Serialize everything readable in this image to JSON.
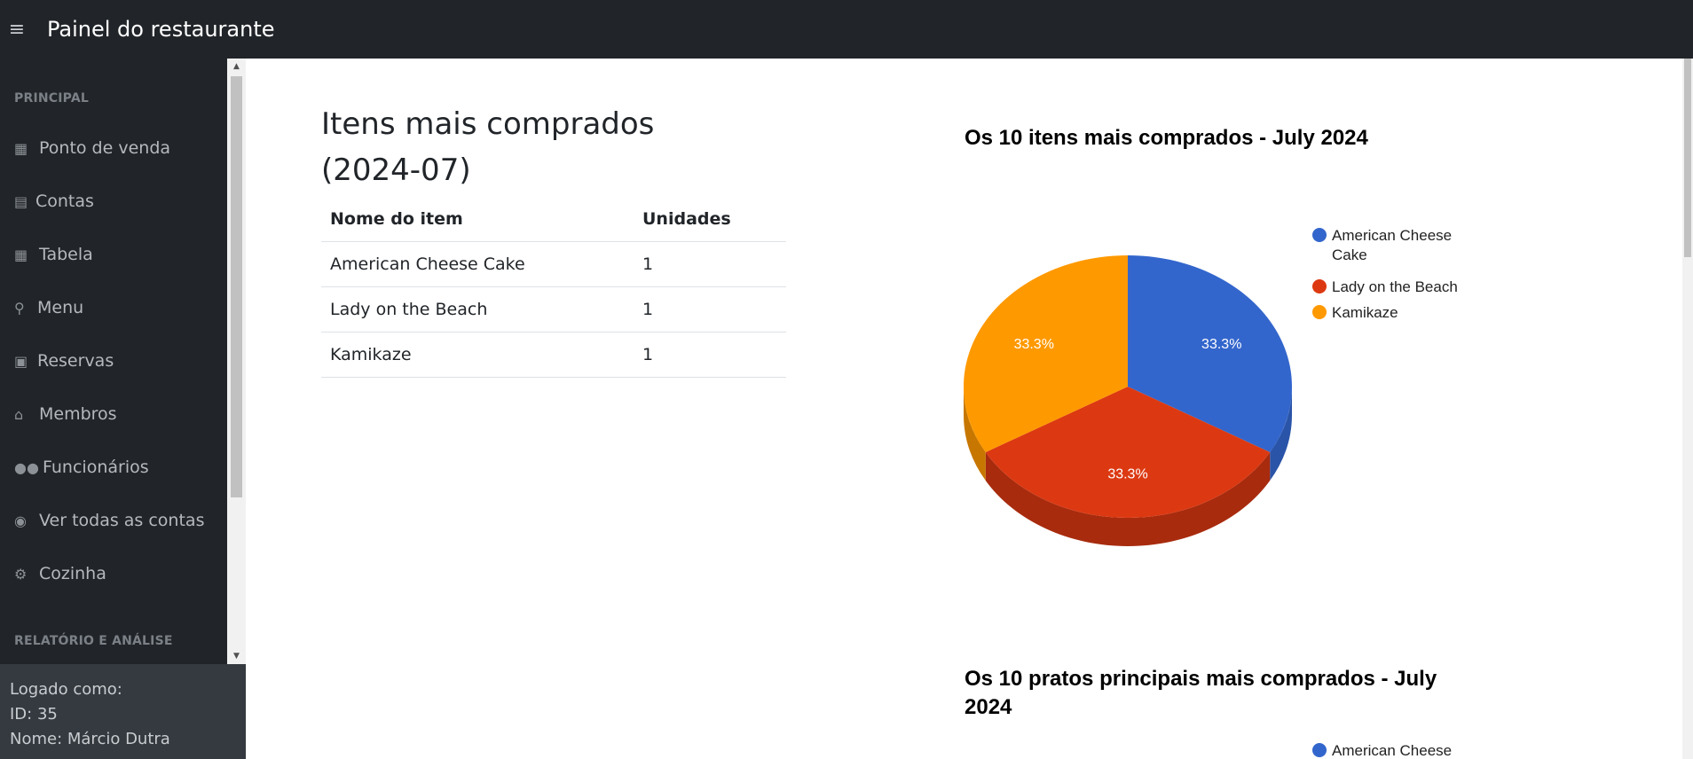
{
  "header": {
    "menu_icon": "hamburger-icon",
    "title": "Painel do restaurante"
  },
  "sidebar": {
    "section_main": "PRINCIPAL",
    "items": [
      {
        "label": "Ponto de venda",
        "icon": "cash-register-icon"
      },
      {
        "label": "Contas",
        "icon": "receipt-icon"
      },
      {
        "label": "Tabela",
        "icon": "table-grid-icon"
      },
      {
        "label": "Menu",
        "icon": "utensils-icon"
      },
      {
        "label": "Reservas",
        "icon": "book-icon"
      },
      {
        "label": "Membros",
        "icon": "house-user-icon"
      },
      {
        "label": "Funcionários",
        "icon": "people-group-icon"
      },
      {
        "label": "Ver todas as contas",
        "icon": "eye-icon"
      },
      {
        "label": "Cozinha",
        "icon": "kitchen-icon"
      }
    ],
    "section_reports": "RELATÓRIO E ANÁLISE",
    "footer": {
      "logged_as": "Logado como:",
      "id": "ID: 35",
      "name": "Nome: Márcio Dutra"
    }
  },
  "main": {
    "title": "Itens mais comprados (2024-07)",
    "table": {
      "headers": [
        "Nome do item",
        "Unidades"
      ],
      "rows": [
        [
          "American Cheese Cake",
          "1"
        ],
        [
          "Lady on the Beach",
          "1"
        ],
        [
          "Kamikaze",
          "1"
        ]
      ]
    },
    "chart2_title": "Os 10 pratos principais mais comprados - July 2024",
    "chart2_legend_first": "American Cheese"
  },
  "chart_data": [
    {
      "type": "pie",
      "title": "Os 10 itens mais comprados - July 2024",
      "categories": [
        "American Cheese Cake",
        "Lady on the Beach",
        "Kamikaze"
      ],
      "values": [
        1,
        1,
        1
      ],
      "slice_labels": [
        "33.3%",
        "33.3%",
        "33.3%"
      ],
      "colors": [
        "#3366cc",
        "#dc3912",
        "#ff9900"
      ],
      "dark_colors": [
        "#2a54a8",
        "#a82b0e",
        "#c77700"
      ],
      "legend_position": "right",
      "3d": true
    }
  ],
  "colors": {
    "topbar": "#212529",
    "sidebar": "#212529",
    "sidebar_footer": "#343a40"
  }
}
